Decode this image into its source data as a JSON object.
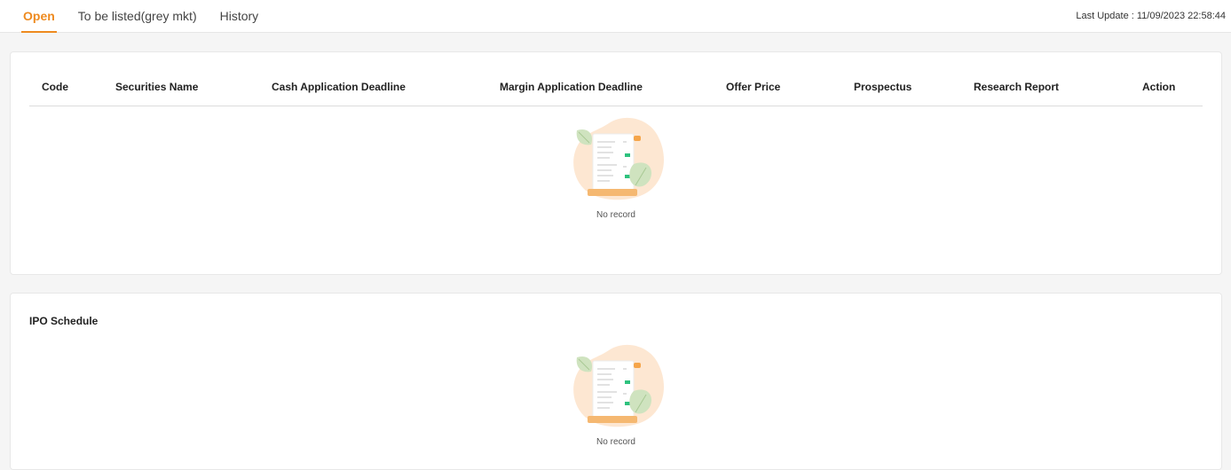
{
  "tabs": [
    {
      "label": "Open",
      "active": true
    },
    {
      "label": "To be listed(grey mkt)",
      "active": false
    },
    {
      "label": "History",
      "active": false
    }
  ],
  "last_update": "Last Update : 11/09/2023 22:58:44",
  "open_table": {
    "columns": [
      "Code",
      "Securities Name",
      "Cash Application Deadline",
      "Margin Application Deadline",
      "Offer Price",
      "Prospectus",
      "Research Report",
      "Action"
    ],
    "empty_text": "No record",
    "empty_icon": "empty-document-icon"
  },
  "ipo_schedule": {
    "title": "IPO Schedule",
    "empty_text": "No record",
    "empty_icon": "empty-document-icon"
  },
  "colors": {
    "accent": "#ee8a1f",
    "leaf": "#cfe3bf",
    "blob": "#fde7d2",
    "tag_green": "#2ec27e"
  }
}
